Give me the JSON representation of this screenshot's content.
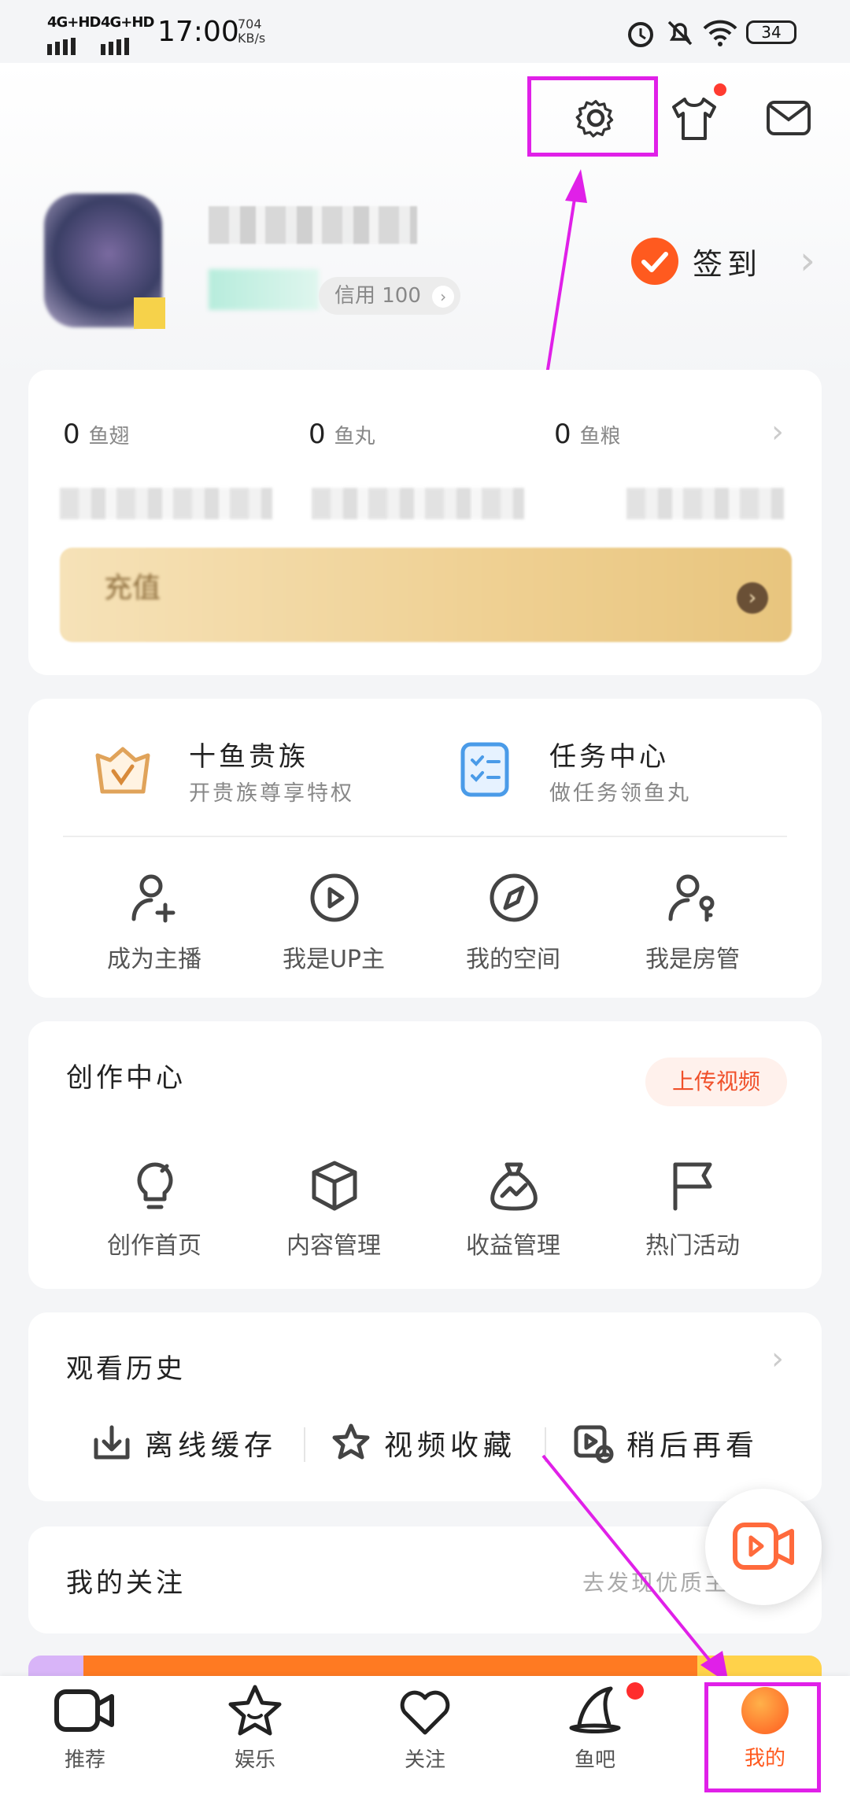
{
  "status_bar": {
    "network1": "4G+HD",
    "network2": "4G+HD",
    "time": "17:00",
    "speed_value": "704",
    "speed_unit": "KB/s",
    "battery": "34"
  },
  "profile": {
    "credit_label": "信用 100",
    "checkin_label": "签到"
  },
  "wallet": {
    "items": [
      {
        "value": "0",
        "label": "鱼翅"
      },
      {
        "value": "0",
        "label": "鱼丸"
      },
      {
        "value": "0",
        "label": "鱼粮"
      }
    ],
    "recharge_label": "充值"
  },
  "services": {
    "noble_title": "十鱼贵族",
    "noble_sub": "开贵族尊享特权",
    "task_title": "任务中心",
    "task_sub": "做任务领鱼丸",
    "grid": [
      {
        "label": "成为主播",
        "icon": "user-add-icon"
      },
      {
        "label": "我是UP主",
        "icon": "play-circle-icon"
      },
      {
        "label": "我的空间",
        "icon": "compass-icon"
      },
      {
        "label": "我是房管",
        "icon": "user-key-icon"
      }
    ]
  },
  "creation": {
    "title": "创作中心",
    "upload_label": "上传视频",
    "items": [
      {
        "label": "创作首页",
        "icon": "lightbulb-icon"
      },
      {
        "label": "内容管理",
        "icon": "box-icon"
      },
      {
        "label": "收益管理",
        "icon": "money-bag-icon"
      },
      {
        "label": "热门活动",
        "icon": "flag-icon"
      }
    ]
  },
  "history": {
    "title": "观看历史",
    "items": [
      {
        "label": "离线缓存",
        "icon": "download-icon"
      },
      {
        "label": "视频收藏",
        "icon": "star-icon"
      },
      {
        "label": "稍后再看",
        "icon": "watch-later-icon"
      }
    ]
  },
  "follow": {
    "title": "我的关注",
    "hint": "去发现优质主"
  },
  "tabbar": [
    {
      "label": "推荐",
      "icon": "video-camera-icon"
    },
    {
      "label": "娱乐",
      "icon": "star-face-icon"
    },
    {
      "label": "关注",
      "icon": "heart-icon"
    },
    {
      "label": "鱼吧",
      "icon": "witch-hat-icon"
    },
    {
      "label": "我的",
      "icon": "profile-avatar-icon"
    }
  ],
  "colors": {
    "accent_orange": "#ff5a1f",
    "highlight_magenta": "#e020e8",
    "upload_text": "#f0502a",
    "upload_bg": "#fff1ec"
  }
}
